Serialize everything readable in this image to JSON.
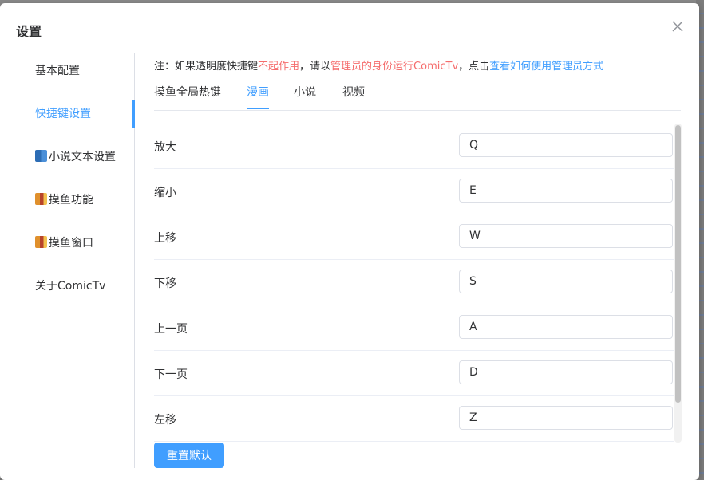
{
  "dialog": {
    "title": "设置",
    "close_icon": "close-icon"
  },
  "sidebar": {
    "items": [
      {
        "label": "基本配置",
        "icon": ""
      },
      {
        "label": "快捷键设置",
        "icon": "",
        "active": true
      },
      {
        "label": "小说文本设置",
        "icon": "book-icon"
      },
      {
        "label": "摸鱼功能",
        "icon": "fish-icon"
      },
      {
        "label": "摸鱼窗口",
        "icon": "fish-icon"
      },
      {
        "label": "关于ComicTv",
        "icon": ""
      }
    ]
  },
  "notice": {
    "prefix": "注：如果透明度快捷键",
    "red1": "不起作用",
    "mid": "，请以",
    "red2": "管理员的身份运行ComicTv",
    "mid2": "，点击",
    "link": "查看如何使用管理员方式"
  },
  "tabs": [
    {
      "label": "摸鱼全局热键"
    },
    {
      "label": "漫画",
      "active": true
    },
    {
      "label": "小说"
    },
    {
      "label": "视频"
    }
  ],
  "shortcuts": [
    {
      "label": "放大",
      "value": "Q"
    },
    {
      "label": "缩小",
      "value": "E"
    },
    {
      "label": "上移",
      "value": "W"
    },
    {
      "label": "下移",
      "value": "S"
    },
    {
      "label": "上一页",
      "value": "A"
    },
    {
      "label": "下一页",
      "value": "D"
    },
    {
      "label": "左移",
      "value": "Z"
    }
  ],
  "footer": {
    "reset_label": "重置默认"
  },
  "colors": {
    "accent": "#409eff",
    "warning": "#f56c6c"
  }
}
